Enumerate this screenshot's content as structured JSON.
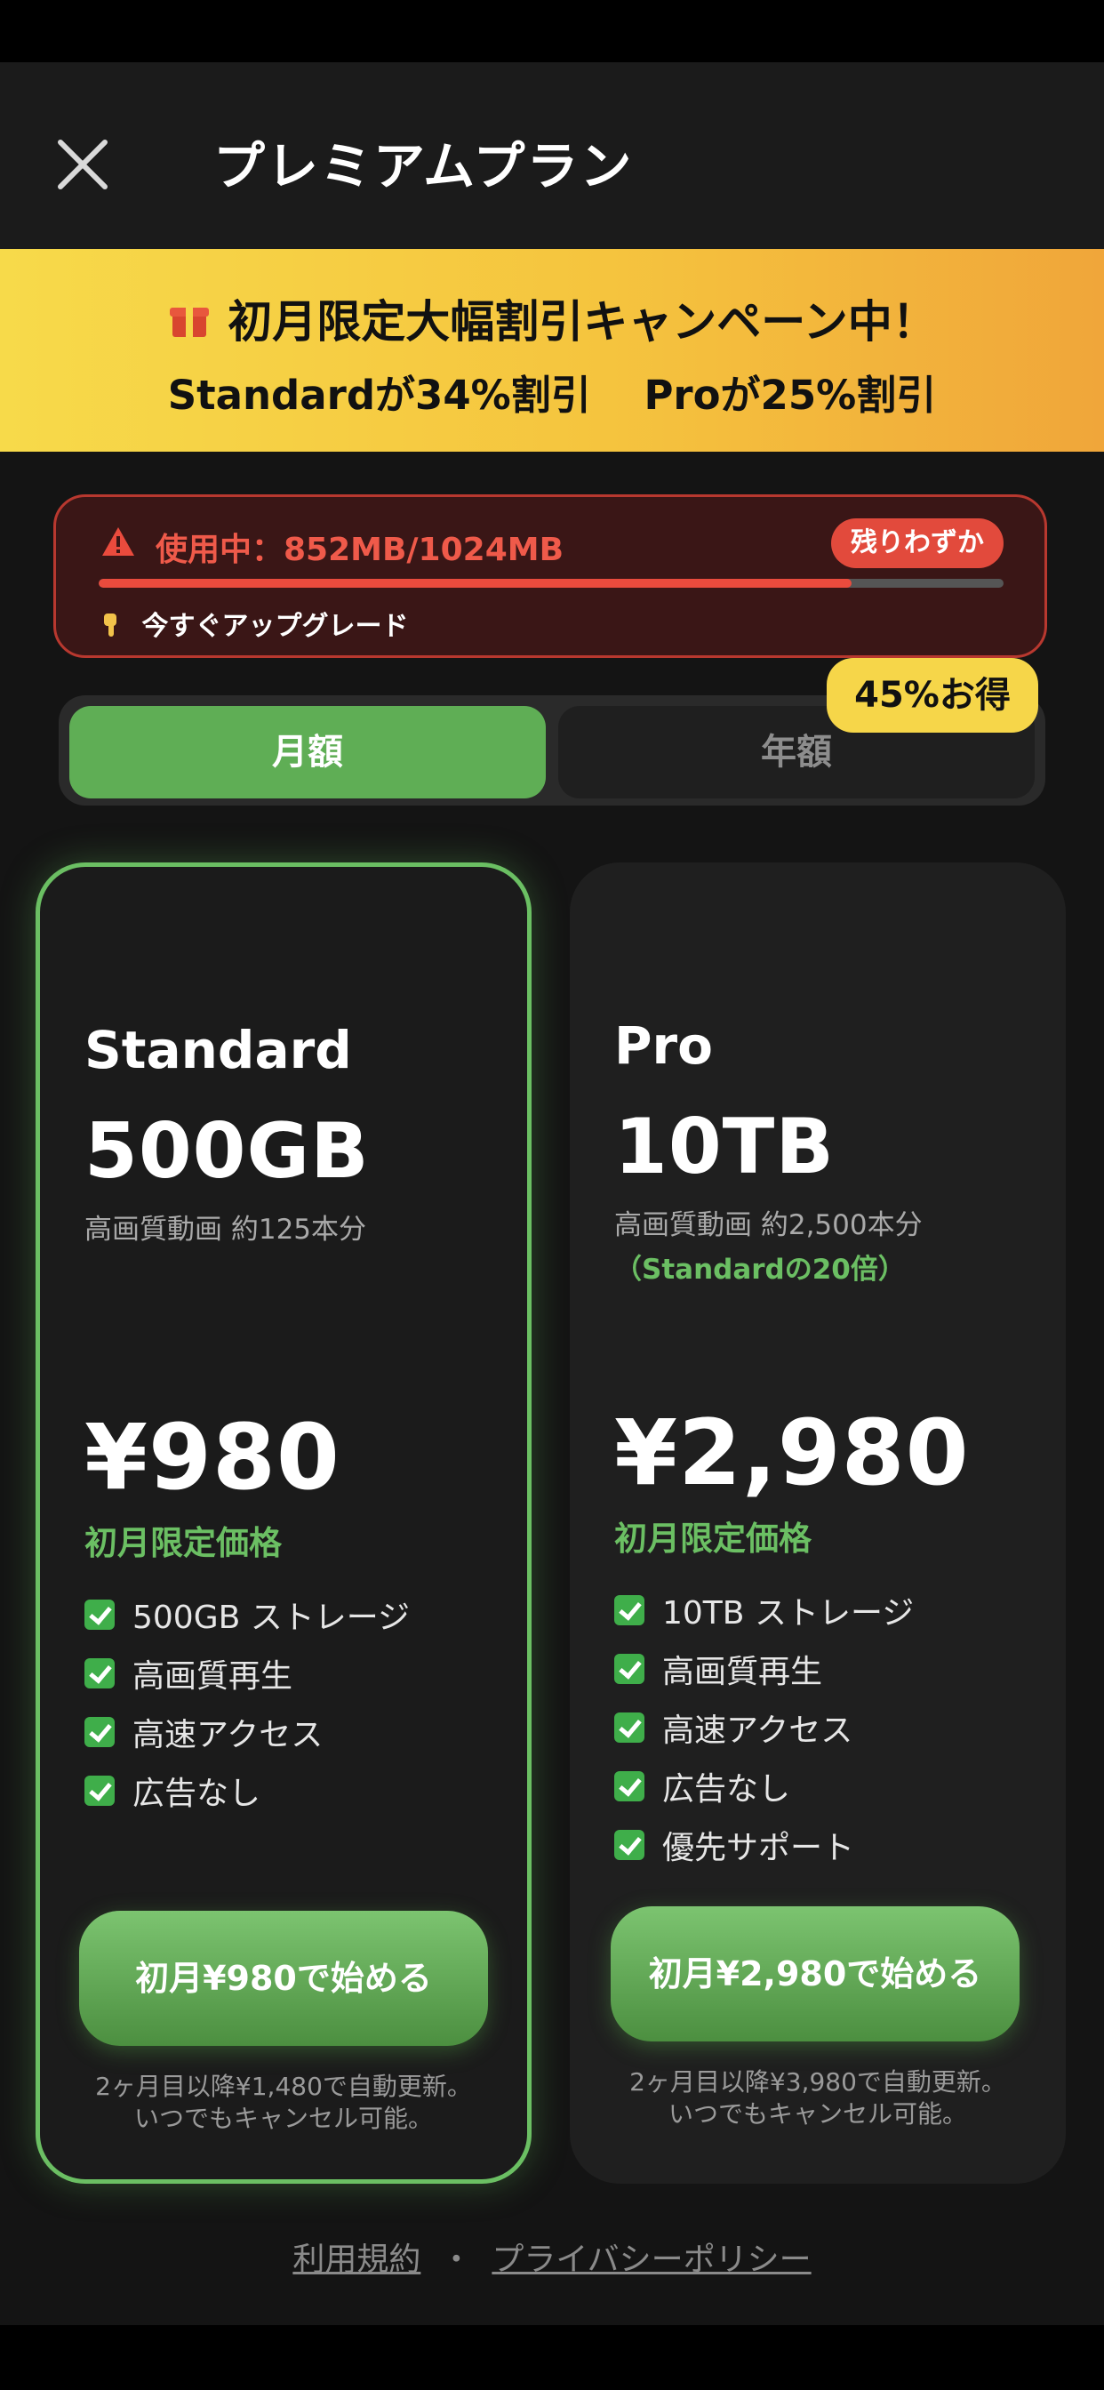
{
  "header": {
    "title": "プレミアムプラン",
    "close_icon": "close-icon"
  },
  "promo": {
    "icon": "gift-icon",
    "headline": "初月限定大幅割引キャンペーン中！",
    "standard_discount": "Standardが34%割引",
    "pro_discount": "Proが25%割引",
    "colors": {
      "gradient_start": "#f7da4a",
      "gradient_end": "#f0a63a"
    }
  },
  "usage": {
    "icon": "warning-icon",
    "text": "使用中：852MB/1024MB",
    "badge": "残りわずか",
    "progress": 0.832,
    "cta_icon": "pointing-down-icon",
    "cta": "今すぐアップグレード",
    "colors": {
      "accent": "#ea4b3d"
    }
  },
  "billing_toggle": {
    "monthly": "月額",
    "yearly": "年額",
    "selected": "monthly",
    "yearly_badge": "45%お得"
  },
  "plans": [
    {
      "name": "Standard",
      "capacity": "500GB",
      "description": "高画質動画 約125本分",
      "price": "¥980",
      "price_note": "初月限定価格",
      "features": [
        "500GB ストレージ",
        "高画質再生",
        "高速アクセス",
        "広告なし"
      ],
      "cta": "初月¥980で始める",
      "renew_line1": "2ヶ月目以降¥1,480で自動更新。",
      "renew_line2": "いつでもキャンセル可能。",
      "selected": true
    },
    {
      "name": "Pro",
      "capacity": "10TB",
      "description": "高画質動画 約2,500本分",
      "description_highlight": "（Standardの20倍）",
      "price": "¥2,980",
      "price_note": "初月限定価格",
      "features": [
        "10TB ストレージ",
        "高画質再生",
        "高速アクセス",
        "広告なし",
        "優先サポート"
      ],
      "cta": "初月¥2,980で始める",
      "renew_line1": "2ヶ月目以降¥3,980で自動更新。",
      "renew_line2": "いつでもキャンセル可能。",
      "selected": false
    }
  ],
  "footer": {
    "terms": "利用規約",
    "separator": "・",
    "privacy": "プライバシーポリシー"
  },
  "colors": {
    "brand_green": "#5fae55",
    "highlight_yellow": "#f6d649",
    "background": "#141414"
  }
}
